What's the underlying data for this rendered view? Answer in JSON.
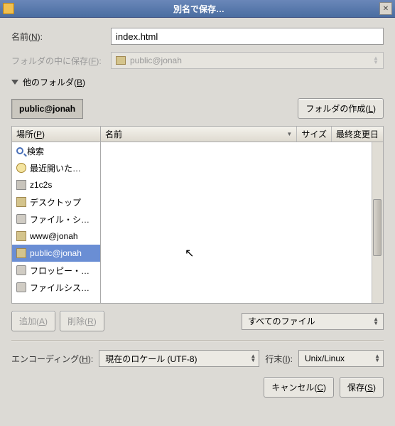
{
  "title": "別名で保存…",
  "name_label_pre": "名前(",
  "name_label_u": "N",
  "name_label_post": "):",
  "name_value": "index.html",
  "folder_label_pre": "フォルダの中に保存(",
  "folder_label_u": "F",
  "folder_label_post": "):",
  "folder_value": "public@jonah",
  "other_folders_pre": "他のフォルダ(",
  "other_folders_u": "B",
  "other_folders_post": ")",
  "path_current": "public@jonah",
  "create_folder_pre": "フォルダの作成(",
  "create_folder_u": "L",
  "create_folder_post": ")",
  "places_header_pre": "場所(",
  "places_header_u": "P",
  "places_header_post": ")",
  "files_header_name": "名前",
  "files_header_size": "サイズ",
  "files_header_date": "最終変更日",
  "places": [
    {
      "label": "検索",
      "icon": "search"
    },
    {
      "label": "最近開いた…",
      "icon": "clock"
    },
    {
      "label": "z1c2s",
      "icon": "home"
    },
    {
      "label": "デスクトップ",
      "icon": "folder"
    },
    {
      "label": "ファイル・シ…",
      "icon": "disk"
    },
    {
      "label": "www@jonah",
      "icon": "folder"
    },
    {
      "label": "public@jonah",
      "icon": "folder",
      "selected": true
    },
    {
      "label": "フロッピー・…",
      "icon": "disk"
    },
    {
      "label": "ファイルシス…",
      "icon": "disk"
    }
  ],
  "add_pre": "追加(",
  "add_u": "A",
  "add_post": ")",
  "remove_pre": "削除(",
  "remove_u": "R",
  "remove_post": ")",
  "file_filter": "すべてのファイル",
  "encoding_label_pre": "エンコーディング(",
  "encoding_label_u": "H",
  "encoding_label_post": "):",
  "encoding_value": "現在のロケール (UTF-8)",
  "lineend_label_pre": "行末(",
  "lineend_label_u": "I",
  "lineend_label_post": "):",
  "lineend_value": "Unix/Linux",
  "cancel_pre": "キャンセル(",
  "cancel_u": "C",
  "cancel_post": ")",
  "save_pre": "保存(",
  "save_u": "S",
  "save_post": ")"
}
